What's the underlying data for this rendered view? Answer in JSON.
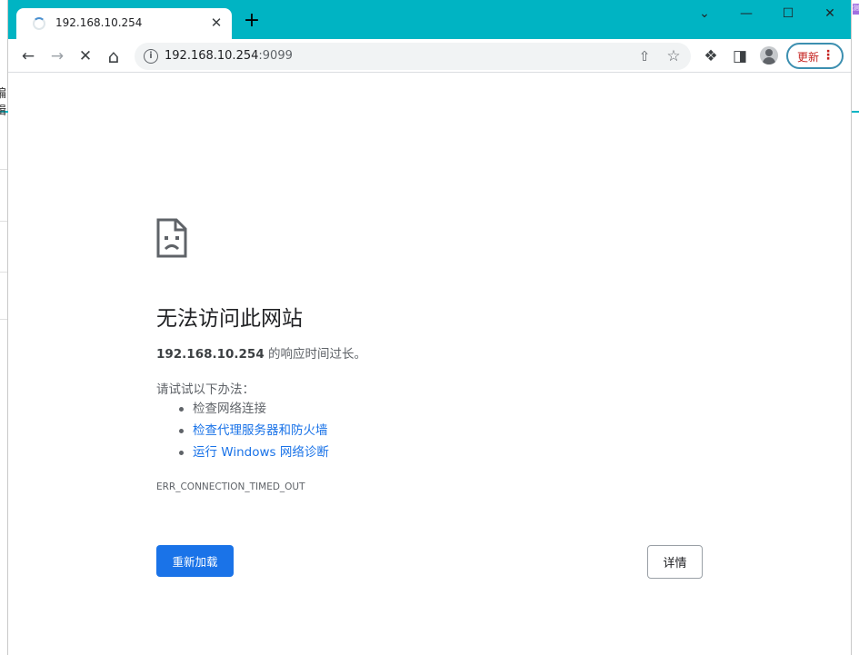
{
  "background_app": {
    "left_text": "编辑",
    "right_badge": "测"
  },
  "tab": {
    "title": "192.168.10.254",
    "close_glyph": "✕",
    "new_tab_glyph": "+"
  },
  "window_controls": {
    "tab_search": "⌄",
    "minimize": "—",
    "maximize": "☐",
    "close": "✕"
  },
  "toolbar": {
    "back": "←",
    "forward": "→",
    "stop": "✕",
    "home": "⌂",
    "url_host": "192.168.10.254",
    "url_port": ":9099",
    "info_glyph": "i",
    "share_glyph": "⇧",
    "star_glyph": "☆",
    "extensions_glyph": "❖",
    "sidepanel_glyph": "◨",
    "update_label": "更新",
    "menu_glyph": "⋮"
  },
  "error_page": {
    "heading": "无法访问此网站",
    "host": "192.168.10.254",
    "summary_suffix": " 的响应时间过长。",
    "try_heading": "请试试以下办法：",
    "suggestions": [
      "检查网络连接",
      "检查代理服务器和防火墙",
      "运行 Windows 网络诊断"
    ],
    "error_code": "ERR_CONNECTION_TIMED_OUT",
    "reload_label": "重新加载",
    "details_label": "详情"
  },
  "colors": {
    "titlebar": "#00b4c3",
    "link": "#1a73e8",
    "primary_button": "#1a73e8",
    "update_text": "#c5221f"
  },
  "icons": {
    "tab_spinner": "loading-spinner-icon",
    "sad_page": "sad-page-icon",
    "avatar": "profile-avatar-icon"
  }
}
